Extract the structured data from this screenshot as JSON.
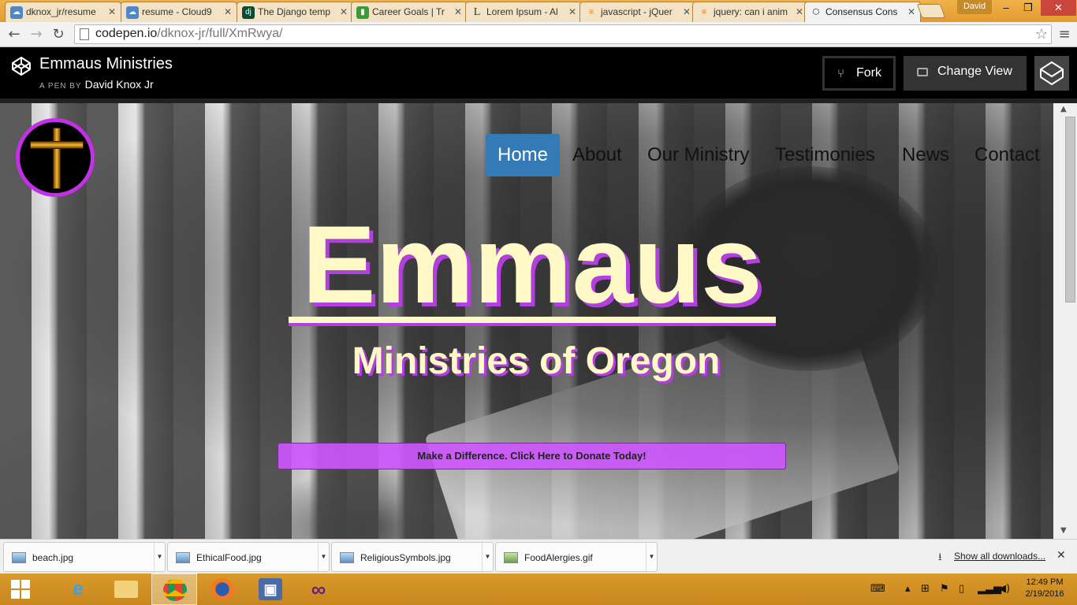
{
  "browser": {
    "tabs": [
      {
        "label": "dknox_jr/resume",
        "icon": "cloud9-icon",
        "active": false
      },
      {
        "label": "resume - Cloud9",
        "icon": "cloud9-icon",
        "active": false
      },
      {
        "label": "The Django temp",
        "icon": "django-icon",
        "active": false
      },
      {
        "label": "Career Goals | Tr",
        "icon": "trello-icon",
        "active": false
      },
      {
        "label": "Lorem Ipsum - Al",
        "icon": "lorem-icon",
        "active": false
      },
      {
        "label": "javascript - jQuer",
        "icon": "stackoverflow-icon",
        "active": false
      },
      {
        "label": "jquery: can i anim",
        "icon": "stackoverflow-icon",
        "active": false
      },
      {
        "label": "Consensus Cons",
        "icon": "codepen-icon",
        "active": true
      }
    ],
    "user": "David",
    "url_host": "codepen.io",
    "url_path": "/dknox-jr/full/XmRwya/"
  },
  "codepen": {
    "pen_title": "Emmaus Ministries",
    "by_prefix": "A PEN BY",
    "author": "David Knox Jr",
    "fork_label": "Fork",
    "change_view_label": "Change View"
  },
  "site": {
    "nav": [
      {
        "label": "Home",
        "active": true
      },
      {
        "label": "About",
        "active": false
      },
      {
        "label": "Our Ministry",
        "active": false
      },
      {
        "label": "Testimonies",
        "active": false
      },
      {
        "label": "News",
        "active": false
      },
      {
        "label": "Contact",
        "active": false
      }
    ],
    "hero_title": "Emmaus",
    "hero_subtitle": "Ministries of Oregon",
    "donate_label": "Make a Difference. Click Here to Donate Today!",
    "colors": {
      "accent_purple": "#c330e8",
      "title_cream": "#fff9c8",
      "nav_active": "#337ab7"
    }
  },
  "downloads": {
    "items": [
      {
        "name": "beach.jpg"
      },
      {
        "name": "EthicalFood.jpg"
      },
      {
        "name": "ReligiousSymbols.jpg"
      },
      {
        "name": "FoodAlergies.gif"
      }
    ],
    "show_all_label": "Show all downloads..."
  },
  "taskbar": {
    "time": "12:49 PM",
    "date": "2/19/2016",
    "apps": [
      "internet-explorer-icon",
      "file-explorer-icon",
      "chrome-icon",
      "firefox-icon",
      "virtualbox-icon",
      "visual-studio-icon"
    ]
  }
}
